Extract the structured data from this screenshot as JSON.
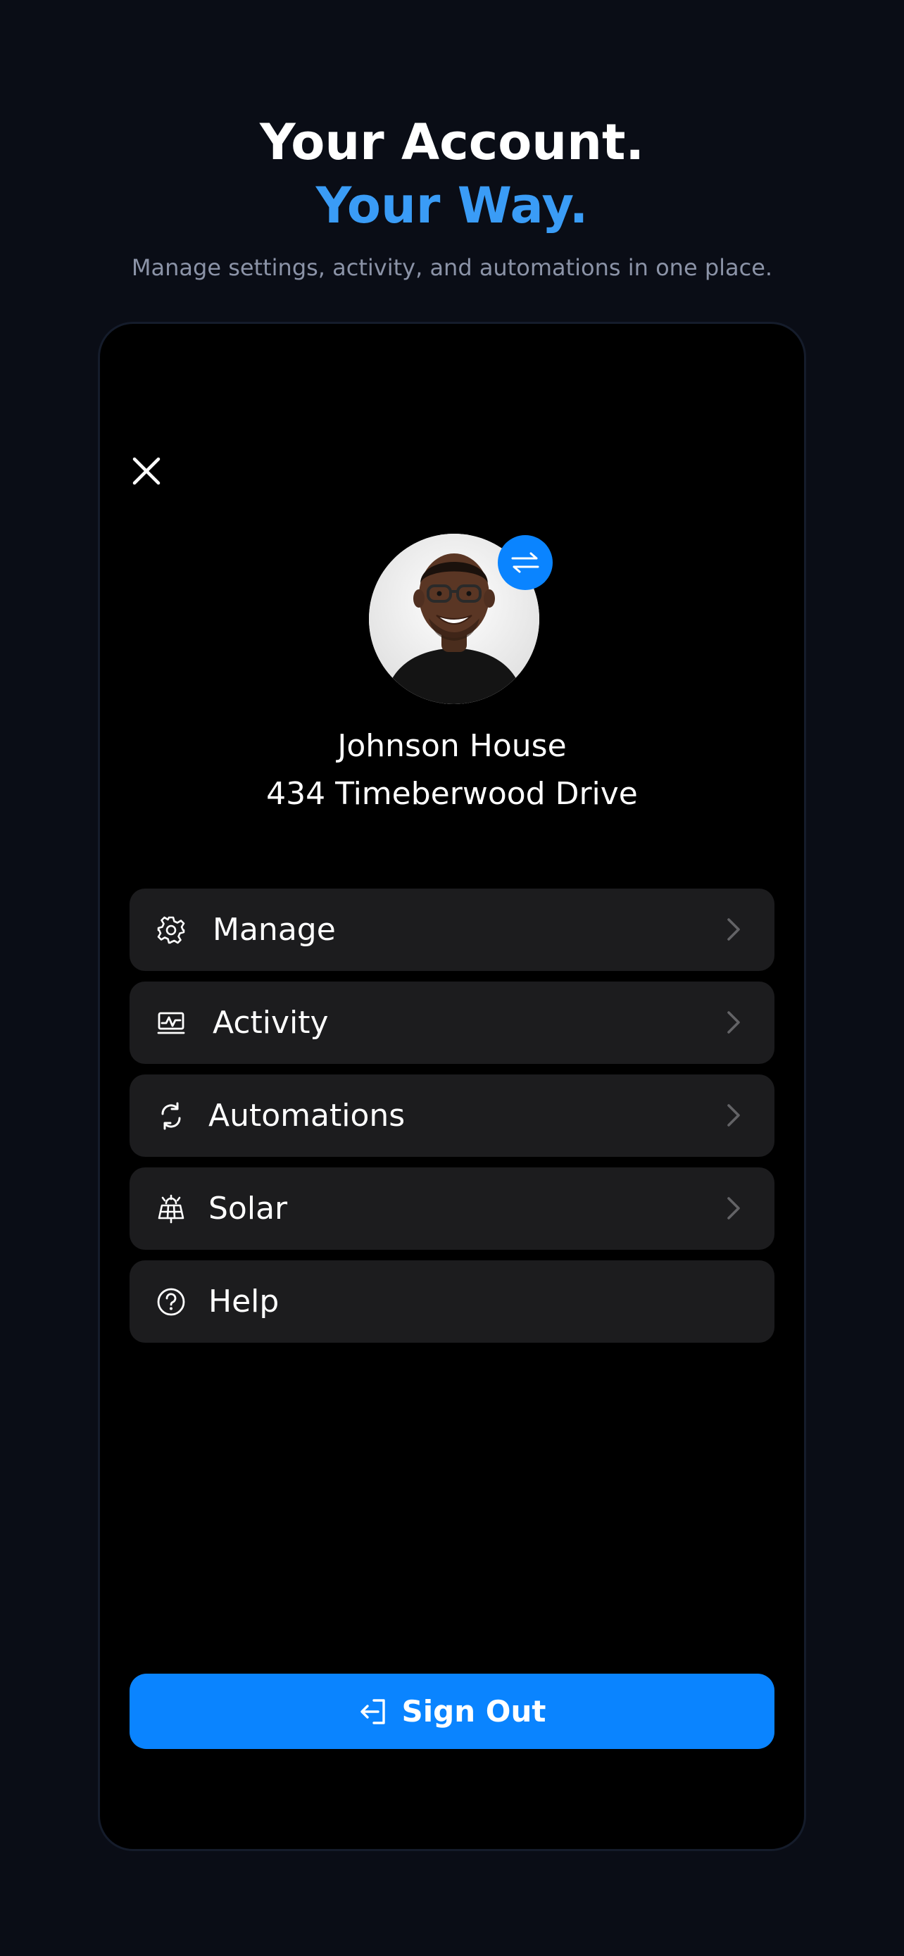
{
  "hero": {
    "title_line1": "Your Account.",
    "title_line2": "Your Way.",
    "subtitle": "Manage settings, activity, and automations in one place."
  },
  "profile": {
    "name": "Johnson House",
    "address": "434 Timeberwood Drive"
  },
  "menu": {
    "items": [
      {
        "label": "Manage",
        "icon": "gear-icon"
      },
      {
        "label": "Activity",
        "icon": "activity-chart-icon"
      },
      {
        "label": "Automations",
        "icon": "refresh-cycle-icon"
      },
      {
        "label": "Solar",
        "icon": "solar-panel-icon"
      },
      {
        "label": "Help",
        "icon": "question-circle-icon"
      }
    ]
  },
  "signout": {
    "label": "Sign Out"
  },
  "colors": {
    "accent": "#0a84ff",
    "hero_accent": "#3a9cf6",
    "background": "#0a0d16",
    "card": "#1c1c1e"
  }
}
